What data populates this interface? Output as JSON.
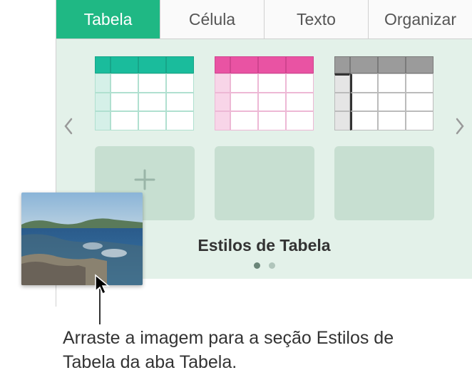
{
  "tabs": {
    "tabela": "Tabela",
    "celula": "Célula",
    "texto": "Texto",
    "organizar": "Organizar"
  },
  "styles": {
    "title": "Estilos de Tabela",
    "add_label": "+"
  },
  "callout": {
    "text": "Arraste a imagem para a seção Estilos de Tabela da aba Tabela."
  }
}
